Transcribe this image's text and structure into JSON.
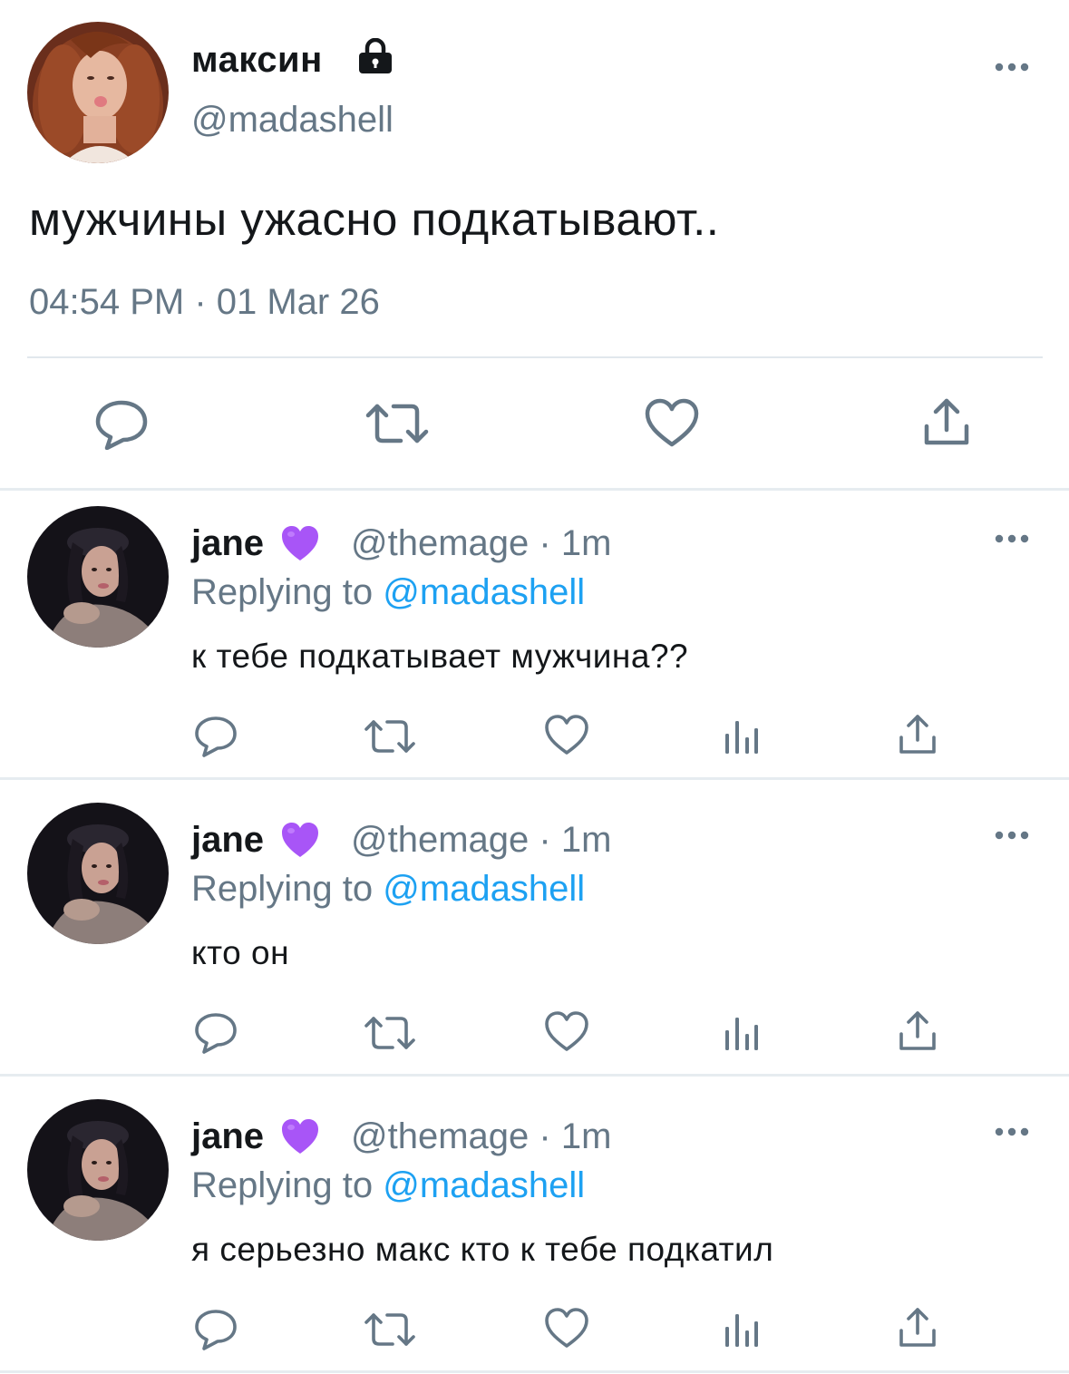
{
  "main_tweet": {
    "display_name": "максин",
    "handle": "@madashell",
    "text": "мужчины ужасно подкатывают..",
    "timestamp": "04:54 PM · 01 Mar 26",
    "locked_icon": "lock-icon",
    "more_icon": "more-icon"
  },
  "actions": {
    "reply_icon": "reply-icon",
    "retweet_icon": "retweet-icon",
    "like_icon": "heart-outline-icon",
    "views_icon": "bar-chart-icon",
    "share_icon": "share-icon"
  },
  "replies": [
    {
      "display_name": "jane",
      "emoji": "💜",
      "meta": "@themage · 1m",
      "replying_prefix": "Replying to ",
      "replying_to": "@madashell",
      "text": "к тебе подкатывает мужчина??"
    },
    {
      "display_name": "jane",
      "emoji": "💜",
      "meta": "@themage · 1m",
      "replying_prefix": "Replying to ",
      "replying_to": "@madashell",
      "text": "кто он"
    },
    {
      "display_name": "jane",
      "emoji": "💜",
      "meta": "@themage · 1m",
      "replying_prefix": "Replying to ",
      "replying_to": "@madashell",
      "text": "я серьезно макс кто к тебе подкатил"
    }
  ],
  "colors": {
    "primary_text": "#14171a",
    "secondary_text": "#657786",
    "link": "#1da1f2",
    "divider": "#e6ecf0",
    "icon_gray": "#657786"
  }
}
